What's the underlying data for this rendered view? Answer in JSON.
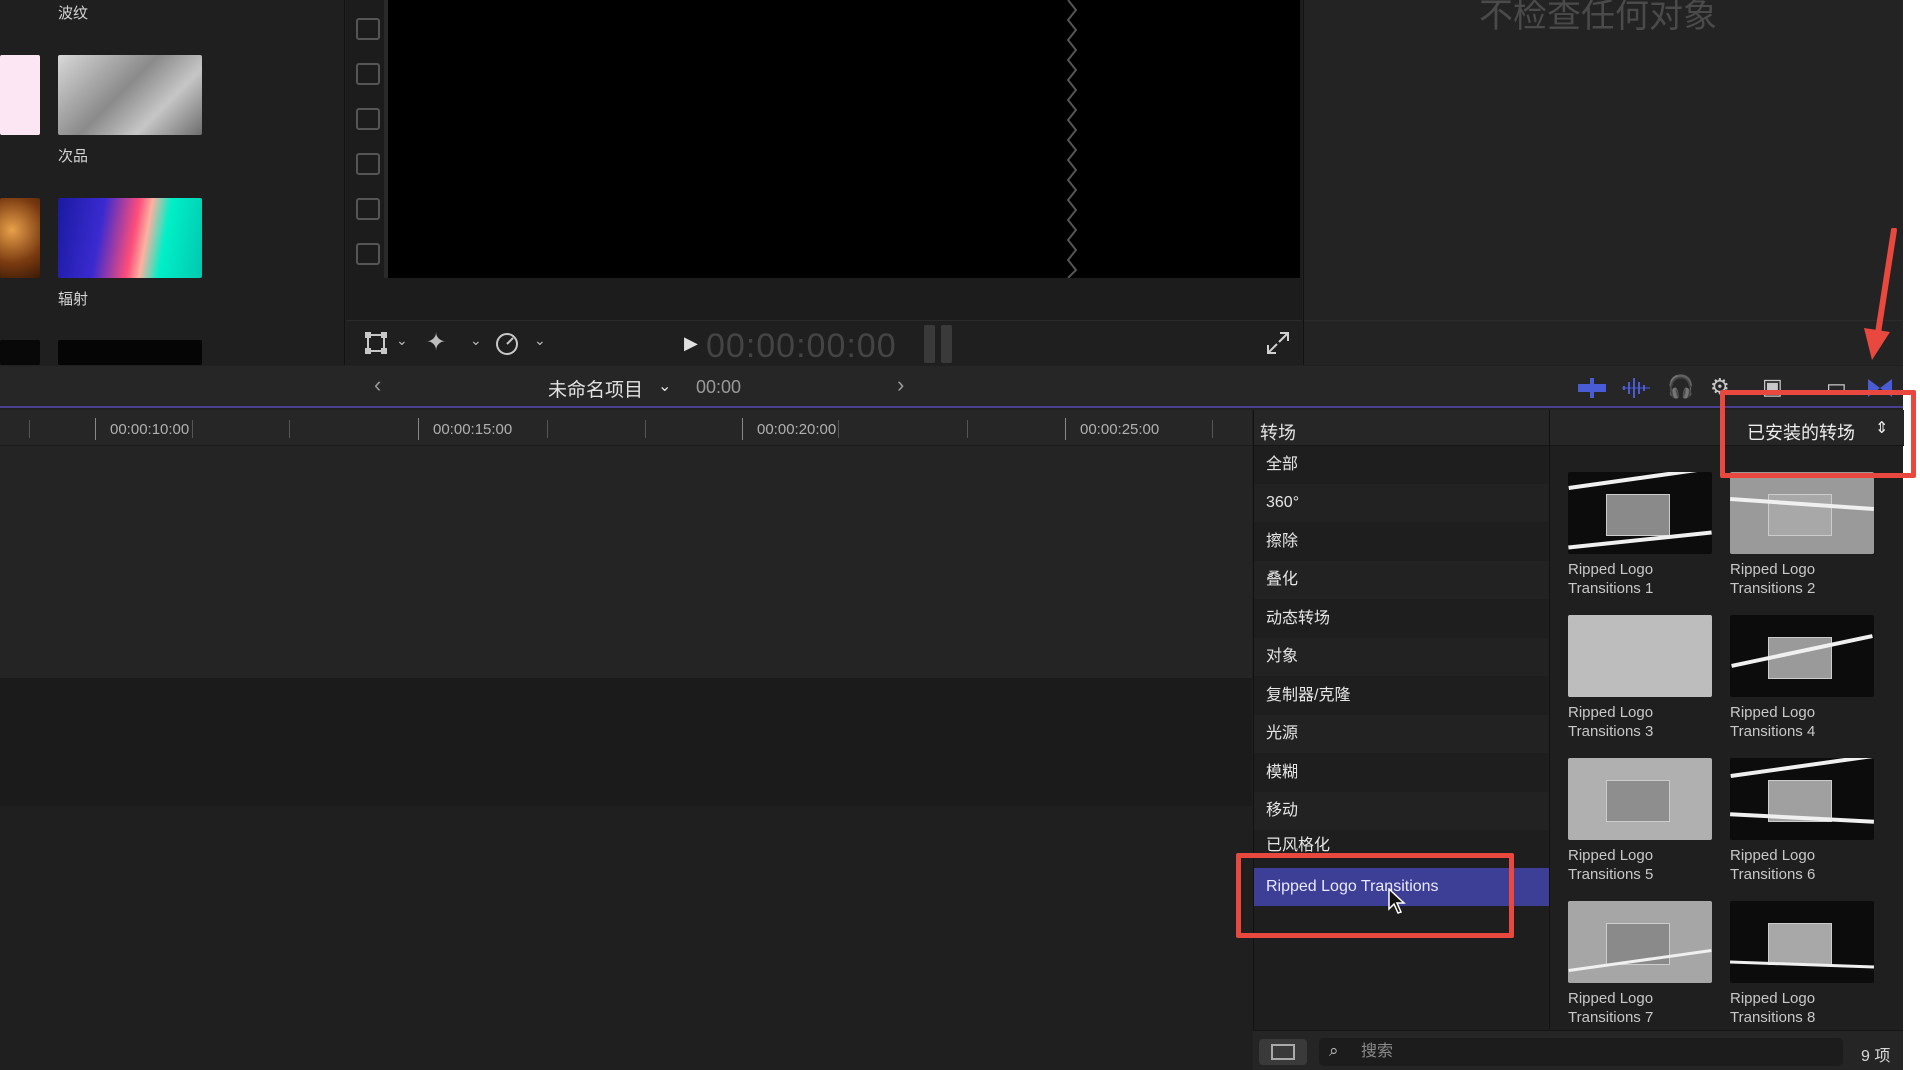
{
  "left_browser": {
    "items": [
      {
        "label": "波纹"
      },
      {
        "label": "次品"
      },
      {
        "label": "辐射"
      }
    ]
  },
  "viewer": {
    "timecode": "00:00:00:00"
  },
  "inspector": {
    "message": "不检查任何对象"
  },
  "timeline_toolbar": {
    "project_name": "未命名项目",
    "project_time": "00:00"
  },
  "ruler": {
    "labels": [
      "00:00:10:00",
      "00:00:15:00",
      "00:00:20:00",
      "00:00:25:00"
    ]
  },
  "transitions": {
    "title": "转场",
    "filter_label": "已安装的转场",
    "categories": [
      "全部",
      "360°",
      "擦除",
      "叠化",
      "动态转场",
      "对象",
      "复制器/克隆",
      "光源",
      "模糊",
      "移动",
      "已风格化",
      "Ripped Logo Transitions"
    ],
    "selected_category": "Ripped Logo Transitions",
    "items": [
      {
        "line1": "Ripped Logo",
        "line2": "Transitions 1"
      },
      {
        "line1": "Ripped Logo",
        "line2": "Transitions 2"
      },
      {
        "line1": "Ripped Logo",
        "line2": "Transitions 3"
      },
      {
        "line1": "Ripped Logo",
        "line2": "Transitions 4"
      },
      {
        "line1": "Ripped Logo",
        "line2": "Transitions 5"
      },
      {
        "line1": "Ripped Logo",
        "line2": "Transitions 6"
      },
      {
        "line1": "Ripped Logo",
        "line2": "Transitions 7"
      },
      {
        "line1": "Ripped Logo",
        "line2": "Transitions 8"
      }
    ]
  },
  "bottom_bar": {
    "search_placeholder": "搜索",
    "item_count": "9 项"
  },
  "colors": {
    "accent_selected": "#3d3e95",
    "annotation_red": "#e8483d",
    "toolbar_blue": "#4a5bd6"
  }
}
